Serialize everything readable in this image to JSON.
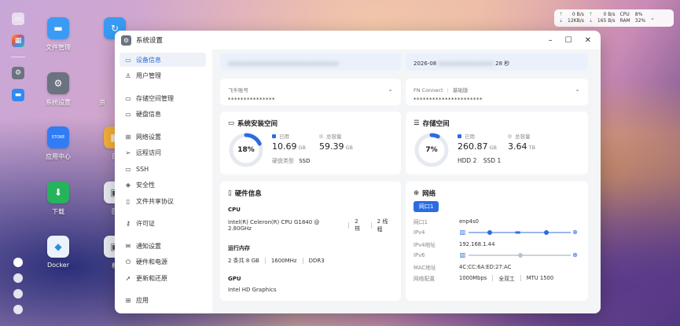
{
  "desktop": {
    "icons": [
      {
        "label": "文件管理"
      },
      {
        "label": "系统设置"
      },
      {
        "label": "应用中心"
      },
      {
        "label": "下载"
      },
      {
        "label": "Docker"
      },
      {
        "label": "资"
      },
      {
        "label": "日"
      },
      {
        "label": "回"
      },
      {
        "label": "相"
      },
      {
        "label": "Z"
      }
    ],
    "store_tile_text": "STORE"
  },
  "net_widget": {
    "up_speed": "0 B/s",
    "down_speed": "12KB/s",
    "up_speed2": "0 B/s",
    "down_speed2": "165 B/s",
    "cpu_label": "CPU",
    "cpu_value": "8%",
    "ram_label": "RAM",
    "ram_value": "32%"
  },
  "window": {
    "title": "系统设置"
  },
  "sidebar": {
    "items": [
      {
        "label": "设备信息",
        "icon": "monitor-icon"
      },
      {
        "label": "用户管理",
        "icon": "user-icon"
      },
      {
        "label": "存储空间管理",
        "icon": "storage-icon"
      },
      {
        "label": "硬盘信息",
        "icon": "disk-icon"
      },
      {
        "label": "网络设置",
        "icon": "network-icon"
      },
      {
        "label": "远程访问",
        "icon": "send-icon"
      },
      {
        "label": "SSH",
        "icon": "terminal-icon"
      },
      {
        "label": "安全性",
        "icon": "shield-icon"
      },
      {
        "label": "文件共享协议",
        "icon": "file-icon"
      },
      {
        "label": "许可证",
        "icon": "key-icon"
      },
      {
        "label": "通知设置",
        "icon": "mail-icon"
      },
      {
        "label": "硬件和电源",
        "icon": "power-icon"
      },
      {
        "label": "更新和还原",
        "icon": "rocket-icon"
      },
      {
        "label": "应用",
        "icon": "apps-icon"
      }
    ]
  },
  "top_strip": {
    "left_blurred": "xxxxxxxxxxxxxxxxxxxxxxxxxxxxxxxxxx",
    "right_date": "2026-08",
    "right_blurred": "xxxxxxxxxxxxxxxxx",
    "right_suffix": "28 秒"
  },
  "feiniu": {
    "label": "飞牛账号",
    "value": "***************"
  },
  "fn_connect": {
    "label": "FN Connect",
    "sublabel": "基础版",
    "value": "**********************"
  },
  "system_space": {
    "title": "系统安装空间",
    "percent": "18%",
    "percent_value": 18,
    "used_label": "已用",
    "used_value": "10.69",
    "used_unit": "GB",
    "total_label": "总容量",
    "total_value": "59.39",
    "total_unit": "GB",
    "disk_type_label": "硬盘类型",
    "disk_type_value": "SSD"
  },
  "storage_space": {
    "title": "存储空间",
    "percent": "7%",
    "percent_value": 7,
    "used_label": "已用",
    "used_value": "260.87",
    "used_unit": "GB",
    "total_label": "总容量",
    "total_value": "3.64",
    "total_unit": "TB",
    "hdd_label": "HDD",
    "hdd_count": "2",
    "ssd_label": "SSD",
    "ssd_count": "1"
  },
  "hardware": {
    "title": "硬件信息",
    "cpu_label": "CPU",
    "cpu_model": "Intel(R) Celeron(R) CPU G1840 @ 2.80GHz",
    "cpu_cores": "2 核",
    "cpu_threads": "2 线程",
    "ram_label": "运行内存",
    "ram_sticks": "2 条共 8 GB",
    "ram_speed": "1600MHz",
    "ram_type": "DDR3",
    "gpu_label": "GPU",
    "gpu_model": "Intel HD Graphics"
  },
  "network": {
    "title": "网络",
    "tab": "网口1",
    "rows": {
      "port_label": "网口1",
      "port_value": "enp4s0",
      "ipv4_label": "IPv4",
      "ipv4_addr_label": "IPv4地址",
      "ipv4_addr_value": "192.168.1.44",
      "ipv6_label": "IPv6",
      "mac_label": "MAC地址",
      "mac_value": "4C:CC:6A:ED:27:AC",
      "config_label": "网络配置",
      "speed": "1000Mbps",
      "duplex": "全双工",
      "mtu": "MTU 1500"
    }
  },
  "colors": {
    "accent": "#2b6de0",
    "ring_track": "#e6e9ef"
  }
}
